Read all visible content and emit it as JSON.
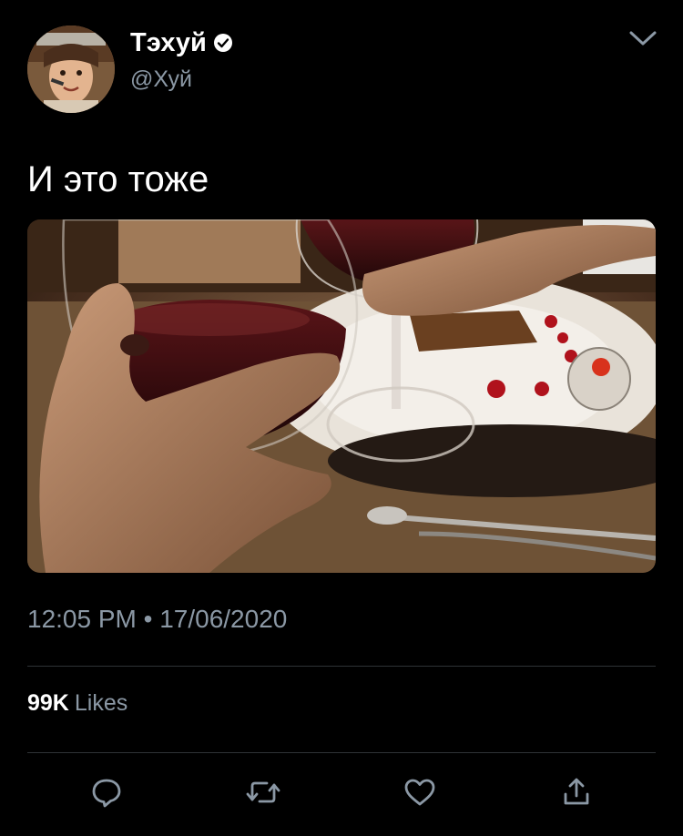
{
  "header": {
    "display_name": "Тэхуй",
    "handle": "@Хуй",
    "verified": true
  },
  "tweet": {
    "text": "И это тоже",
    "timestamp": "12:05 PM • 17/06/2020"
  },
  "engagement": {
    "likes_count": "99K",
    "likes_label": "Likes"
  },
  "icons": {
    "menu": "chevron-down-icon",
    "reply": "reply-icon",
    "retweet": "retweet-icon",
    "like": "heart-icon",
    "share": "share-icon"
  },
  "colors": {
    "background": "#000000",
    "text_primary": "#ffffff",
    "text_secondary": "#8b98a5",
    "divider": "#2f3336",
    "icon": "#8b98a5"
  }
}
